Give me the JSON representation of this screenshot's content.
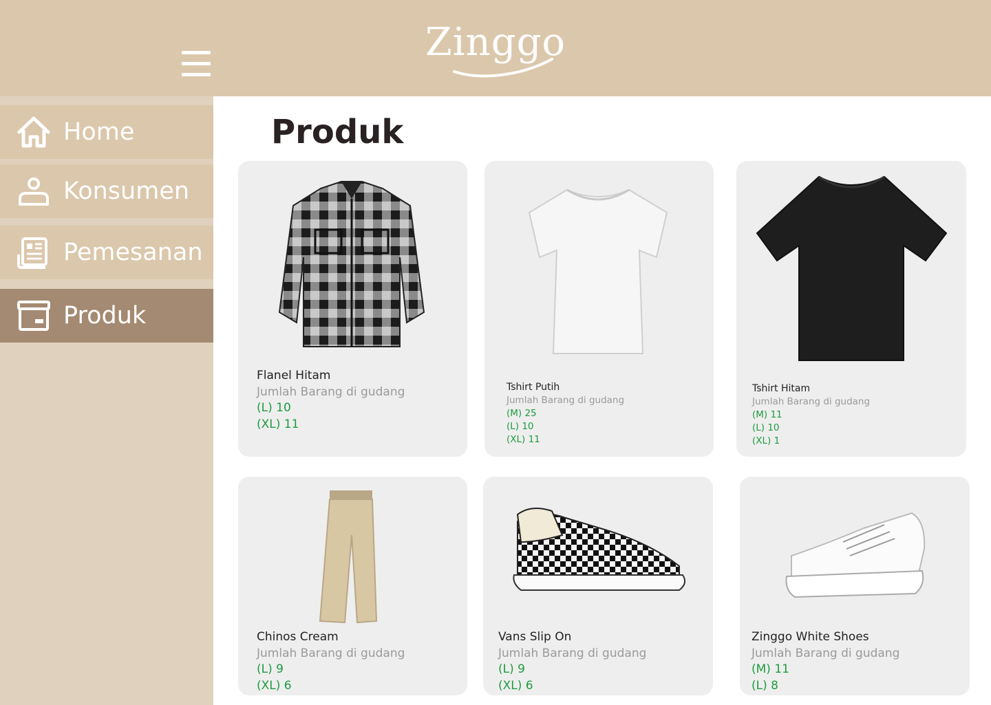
{
  "app": {
    "logo": "Zinggo"
  },
  "header": {
    "menu_icon": "hamburger-menu-icon"
  },
  "sidebar": {
    "items": [
      {
        "label": "Home",
        "icon": "home-icon",
        "active": false
      },
      {
        "label": "Konsumen",
        "icon": "user-icon",
        "active": false
      },
      {
        "label": "Pemesanan",
        "icon": "receipt-icon",
        "active": false
      },
      {
        "label": "Produk",
        "icon": "archive-box-icon",
        "active": true
      }
    ]
  },
  "main": {
    "title": "Produk",
    "products": [
      {
        "name": "Flanel Hitam",
        "stock_label": "Jumlah Barang di gudang",
        "stock": [
          "(L) 10",
          "(XL) 11"
        ],
        "image": "flannel-shirt-image"
      },
      {
        "name": "Tshirt Putih",
        "stock_label": "Jumlah Barang di gudang",
        "stock": [
          "(M) 25",
          "(L) 10",
          "(XL) 11"
        ],
        "image": "white-tshirt-image"
      },
      {
        "name": "Tshirt Hitam",
        "stock_label": "Jumlah Barang di gudang",
        "stock": [
          "(M) 11",
          "(L) 10",
          "(XL) 1"
        ],
        "image": "black-tshirt-image"
      },
      {
        "name": "Chinos Cream",
        "stock_label": "Jumlah Barang di gudang",
        "stock": [
          "(L) 9",
          "(XL) 6"
        ],
        "image": "chinos-pants-image"
      },
      {
        "name": "Vans Slip On",
        "stock_label": "Jumlah Barang di gudang",
        "stock": [
          "(L) 9",
          "(XL) 6"
        ],
        "image": "slip-on-shoe-image"
      },
      {
        "name": "Zinggo White Shoes",
        "stock_label": "Jumlah Barang di gudang",
        "stock": [
          "(M) 11",
          "(L) 8"
        ],
        "image": "white-sneaker-image"
      }
    ]
  },
  "colors": {
    "header_bg": "#dbc7ab",
    "sidebar_bg": "#e0d1be",
    "nav_item_bg": "#dbc7ab",
    "nav_active_bg": "#a48a72",
    "card_bg": "#eeeeee",
    "stock_text": "#1d9b3f",
    "muted_text": "#9a9a9a"
  }
}
